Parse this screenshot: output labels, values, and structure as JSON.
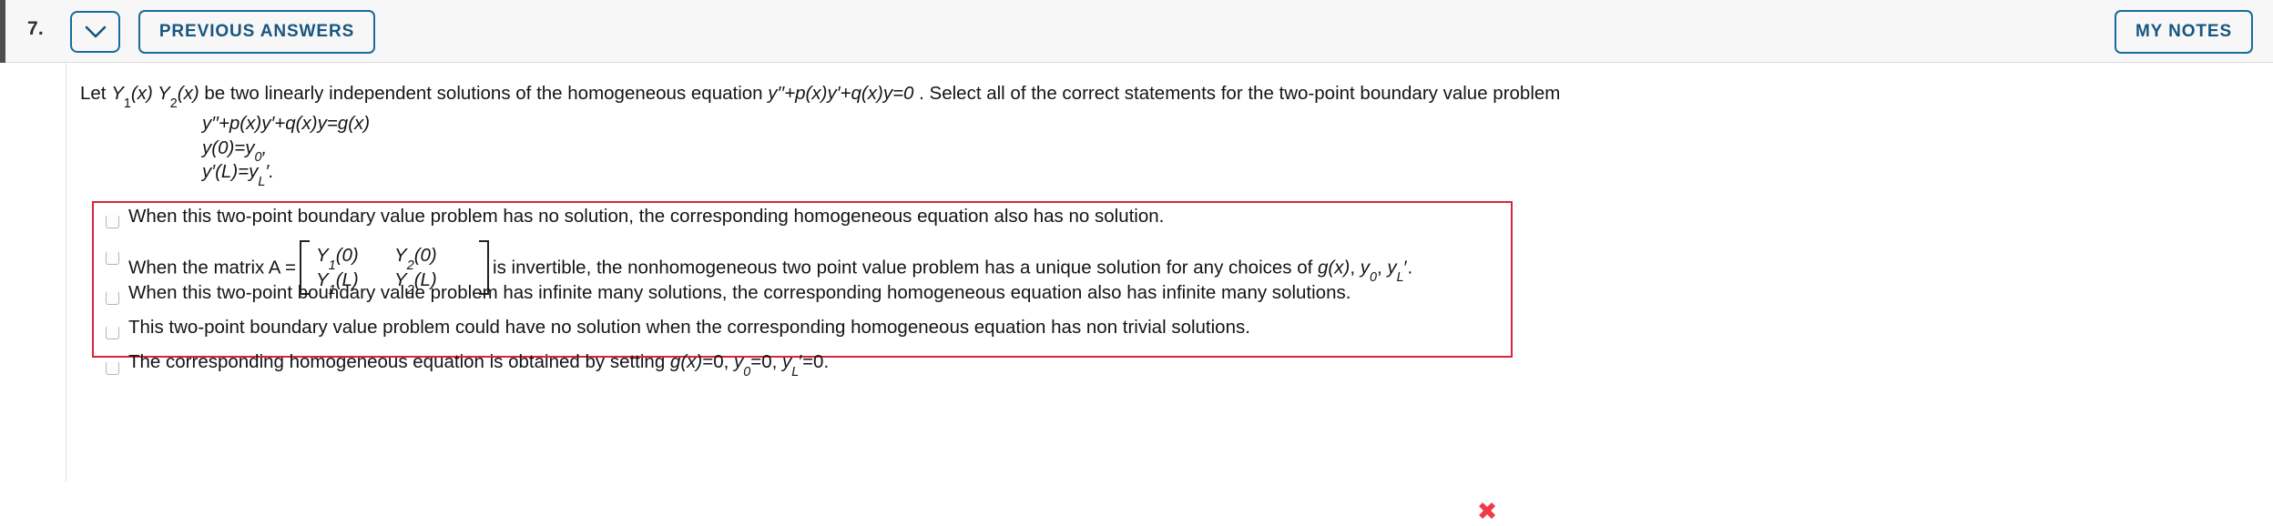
{
  "header": {
    "question_number": "7.",
    "collapse_icon": "chevron-down-icon",
    "previous_answers_label": "PREVIOUS ANSWERS",
    "my_notes_label": "MY NOTES",
    "accent_color": "#1b6a9c",
    "background_color": "#f7f7f7"
  },
  "question": {
    "prompt_parts": {
      "lead": "Let ",
      "y1": "Y",
      "y1_sub": "1",
      "y1_arg": "(x) ",
      "y2": "Y",
      "y2_sub": "2",
      "y2_arg": "(x)",
      "middle": " be two linearly independent solutions of the homogeneous equation ",
      "equation": "y′′+p(x)y′+q(x)y=0",
      "tail": " . Select all of the correct statements for the two-point boundary value problem"
    },
    "prompt_plain": "Let Y1(x) Y2(x) be two linearly independent solutions of the homogeneous equation y''+p(x)y'+q(x)y=0 . Select all of the correct statements for the two-point boundary value problem",
    "system": {
      "line1": "y′′+p(x)y′+q(x)y=g(x)",
      "line2_lhs": "y(0)=y",
      "line2_sub": "0",
      "line2_tail": ",",
      "line3_lhs": "y′(L)=y",
      "line3_sub": "L",
      "line3_tail": "′."
    }
  },
  "answers": {
    "border_color": "#d6263c",
    "status_icon": "incorrect-x-icon",
    "status_symbol": "✖",
    "status_color": "#f2394a",
    "options": [
      {
        "id": "option-0",
        "checked": false,
        "text": "When this two-point boundary value problem has no solution, the corresponding homogeneous equation also has no solution."
      },
      {
        "id": "option-1",
        "checked": false,
        "text_before": "When the matrix A =",
        "matrix": {
          "r1c1_name": "Y",
          "r1c1_sub": "1",
          "r1c1_arg": "(0)",
          "r1c2_name": "Y",
          "r1c2_sub": "2",
          "r1c2_arg": "(0)",
          "r2c1_name": "Y",
          "r2c1_sub": "1",
          "r2c1_arg": "(L)",
          "r2c2_name": "Y",
          "r2c2_sub": "2",
          "r2c2_arg": "(L)"
        },
        "text_after_1": "is invertible, the nonhomogeneous two point value problem has a unique solution for any choices of ",
        "text_after_gx": "g(x)",
        "text_after_2": ", ",
        "text_after_y0": "y",
        "text_after_y0_sub": "0",
        "text_after_3": ", ",
        "text_after_yl": "y",
        "text_after_yl_sub": "L",
        "text_after_4": "′.",
        "text_plain": "When the matrix A = [ Y1(0) Y2(0) ; Y1(L) Y2(L) ] is invertible, the nonhomogeneous two point value problem has a unique solution for any choices of g(x), y0, yL'."
      },
      {
        "id": "option-2",
        "checked": false,
        "text": "When this two-point boundary value problem has infinite many solutions, the corresponding homogeneous equation also has infinite many solutions."
      },
      {
        "id": "option-3",
        "checked": false,
        "text": "This two-point boundary value problem could have no solution when the corresponding homogeneous equation has non trivial solutions."
      },
      {
        "id": "option-4",
        "checked": false,
        "text_before": "The corresponding homogeneous equation is obtained by setting ",
        "gx": "g(x)",
        "mid1": "=0, ",
        "y0": "y",
        "y0_sub": "0",
        "mid2": "=0, ",
        "yl": "y",
        "yl_sub": "L",
        "tail": "′=0.",
        "text_plain": "The corresponding homogeneous equation is obtained by setting g(x)=0, y0=0, yL'=0."
      }
    ]
  }
}
